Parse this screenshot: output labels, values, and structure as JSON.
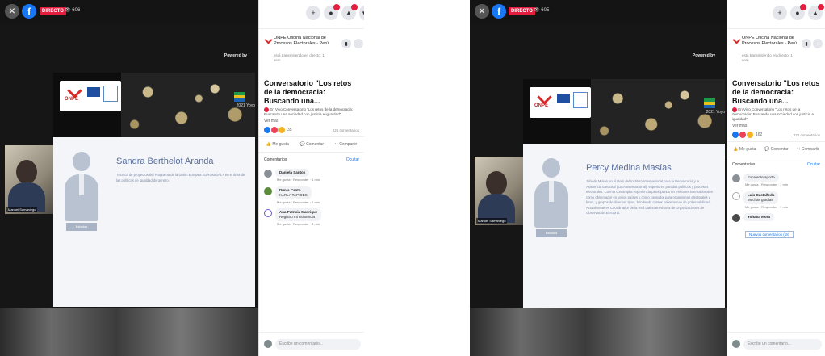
{
  "screens": [
    {
      "topbar": {
        "live": "DIRECTO",
        "views": "606"
      },
      "powered_by": "Powered by",
      "banner": {
        "logo_text": "ONPE",
        "side_text": "2021 Yoyo"
      },
      "speaker": {
        "name": "Sandra Berthelot Aranda",
        "bio": "Técnica de proyectos del Programa de la Unión Europea EUROsociAL+ en el área de las políticas de igualdad de género.",
        "badge": "Estados"
      },
      "webcam_label": "Manuel Samaniego",
      "panel": {
        "page_name": "ONPE Oficina Nacional de Procesos Electorales - Perú",
        "page_sub": "está transmitiendo en directo. 1 sem",
        "title": "Conversatorio \"Los retos de la democracia: Buscando una...",
        "description": "En Vivo Conversatorio \"Los retos de la democracia: Buscando una sociedad con justicia e igualdad\"",
        "see_more": "Ver más",
        "reactions": "35",
        "comments_count": "225 comentarios",
        "actions": [
          "Me gusta",
          "Comentar",
          "Compartir"
        ],
        "comments_header": "Comentarios",
        "comments_toggle": "Ocultar",
        "comments": [
          {
            "name": "Daniela Santos",
            "text": "",
            "meta": "Me gusta · Responder · 1 min"
          },
          {
            "name": "Dunia Canto",
            "text": "KARLA TAPIDES",
            "meta": "Me gusta · Responder · 1 min"
          },
          {
            "name": "Ana Patricia Manrique",
            "text": "Registro mi asistencia",
            "meta": "Me gusta · Responder · 2 min"
          }
        ],
        "new_comments": "",
        "comment_placeholder": "Escribe un comentario..."
      }
    },
    {
      "topbar": {
        "live": "DIRECTO",
        "views": "605"
      },
      "powered_by": "Powered by",
      "banner": {
        "logo_text": "ONPE",
        "side_text": "2021 Yoyo"
      },
      "speaker": {
        "name": "Percy Medina Masías",
        "bio": "Jefe de Misión en el Perú del Instituto Internacional para la Democracia y la Asistencia Electoral (IDEA Internacional), experto en partidos políticos y procesos electorales. Cuenta con amplia experiencia participando en misiones internacionales como observador en varios países y como consultor para organismos electorales y foros, y grupos de diversos tipos, brindando cursos sobre temas de gobernabilidad. Actualmente es Coordinador de la Red Latinoamericana de Organizaciones de Observación Electoral.",
        "badge": "Estados"
      },
      "webcam_label": "Manuel Samaniego",
      "panel": {
        "page_name": "ONPE Oficina Nacional de Procesos Electorales - Perú",
        "page_sub": "está transmitiendo en directo. 1 sem",
        "title": "Conversatorio \"Los retos de la democracia: Buscando una...",
        "description": "En Vivo Conversatorio \"Los retos de la democracia: Buscando una sociedad con justicia e igualdad\"",
        "see_more": "Ver más",
        "reactions": "162",
        "comments_count": "222 comentarios",
        "actions": [
          "Me gusta",
          "Comentar",
          "Compartir"
        ],
        "comments_header": "Comentarios",
        "comments_toggle": "Ocultar",
        "comments": [
          {
            "name": "",
            "text": "Excelente aporte",
            "meta": "Me gusta · Responder · 1 min"
          },
          {
            "name": "Luis Castañeda",
            "text": "Muchas gracias",
            "meta": "Me gusta · Responder · 1 min"
          },
          {
            "name": "Yohana Mora",
            "text": "",
            "meta": "Me gusta · Responder · 1 min"
          }
        ],
        "new_comments": "Nuevos comentarios (18)",
        "comment_placeholder": "Escribe un comentario..."
      }
    }
  ]
}
